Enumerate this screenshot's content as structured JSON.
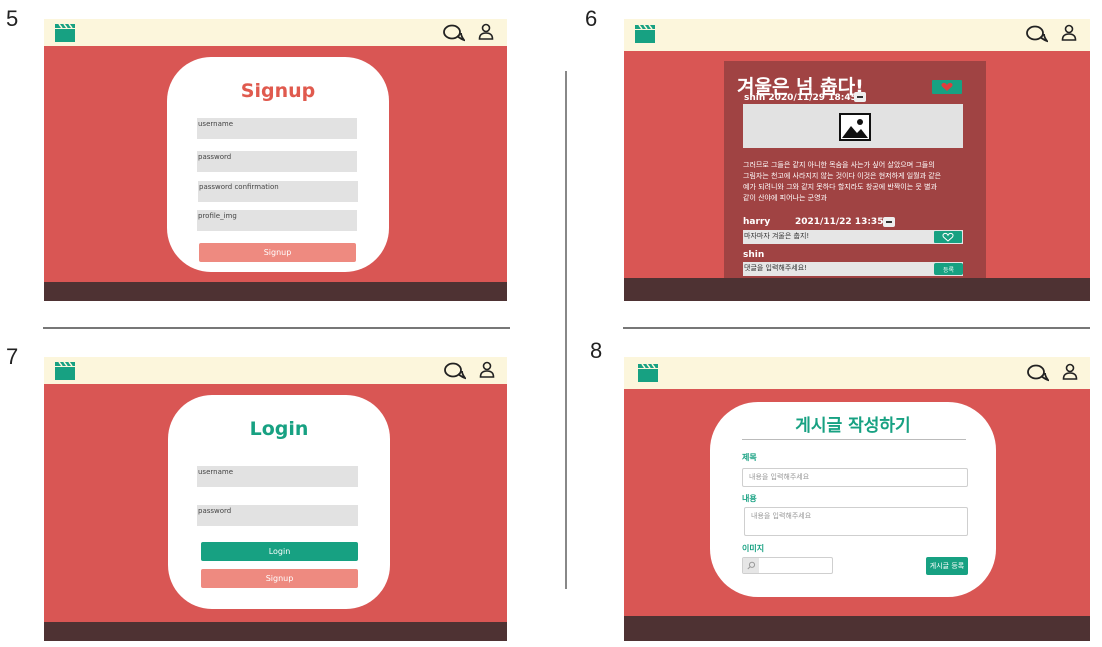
{
  "steps": {
    "s5": "5",
    "s6": "6",
    "s7": "7",
    "s8": "8"
  },
  "colors": {
    "background": "#d95654",
    "topbar": "#fcf6dc",
    "footer": "#4e3233",
    "accent_green": "#17a182",
    "accent_pink": "#ee8a80",
    "signup_title": "#e05a4e"
  },
  "icons": {
    "logo": "clapperboard-icon",
    "chat": "chat-bubbles-icon",
    "user": "user-icon"
  },
  "signup": {
    "title": "Signup",
    "fields": [
      "username",
      "password",
      "password confirmation",
      "profile_img"
    ],
    "button": "Signup"
  },
  "post_detail": {
    "title": "겨울은 넘 춥다!",
    "author_date": "shin 2020/11/29 18:45",
    "body": [
      "그러므로 그들은 같지 아니한 목숨을 사는가 싶어 살았으며 그들의",
      "그림자는 천고에 사라지지 않는 것이다 이것은 현저하게 일월과 같은",
      "예가 되려니와 그와 같지 못하다 할지라도 창공에 반짝이는 뭇 별과",
      "같이 산야에 피어나는 군영과"
    ],
    "comment": {
      "author": "harry",
      "date": "2021/11/22 13:35",
      "text": "마자마자 겨울은 춥지!"
    },
    "reply": {
      "author": "shin",
      "placeholder": "댓글을 입력해주세요!",
      "submit": "등록"
    }
  },
  "login": {
    "title": "Login",
    "fields": [
      "username",
      "password"
    ],
    "login_button": "Login",
    "signup_button": "Signup"
  },
  "write_post": {
    "title": "게시글 작성하기",
    "title_label": "제목",
    "title_placeholder": "내용을 입력해주세요",
    "content_label": "내용",
    "content_placeholder": "내용을 입력해주세요",
    "image_label": "이미지",
    "submit": "게시글 등록"
  }
}
